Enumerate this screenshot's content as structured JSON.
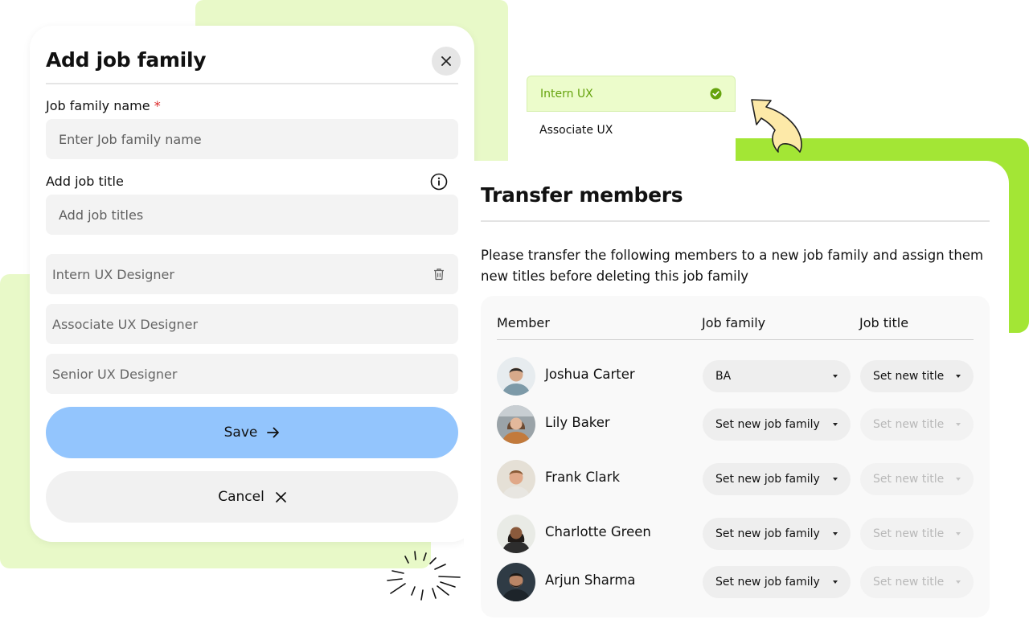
{
  "add_job_family_modal": {
    "title": "Add job family",
    "job_family_name_label": "Job family name",
    "required_marker": "*",
    "job_family_name_placeholder": "Enter Job family name",
    "add_job_title_label": "Add job title",
    "add_job_title_placeholder": "Add job titles",
    "job_titles": [
      "Intern UX Designer",
      "Associate UX Designer",
      "Senior UX Designer"
    ],
    "save_label": "Save",
    "cancel_label": "Cancel"
  },
  "title_dropdown": {
    "options": [
      {
        "label": "Intern UX",
        "selected": true
      },
      {
        "label": "Associate UX",
        "selected": false
      }
    ]
  },
  "transfer_members": {
    "title": "Transfer members",
    "description": "Please transfer the following members to a new job family and assign them new titles before deleting this job family",
    "columns": [
      "Member",
      "Job family",
      "Job title"
    ],
    "members": [
      {
        "name": "Joshua Carter",
        "job_family": "BA",
        "job_title": "Set new title",
        "title_enabled": true
      },
      {
        "name": "Lily Baker",
        "job_family": "Set new job family",
        "job_title": "Set new title",
        "title_enabled": false
      },
      {
        "name": "Frank Clark",
        "job_family": "Set new job family",
        "job_title": "Set new title",
        "title_enabled": false
      },
      {
        "name": "Charlotte Green",
        "job_family": "Set new job family",
        "job_title": "Set new title",
        "title_enabled": false
      },
      {
        "name": "Arjun Sharma",
        "job_family": "Set new job family",
        "job_title": "Set new title",
        "title_enabled": false
      }
    ]
  },
  "colors": {
    "lime_light": "#e8f9c8",
    "lime_accent": "#a3e635",
    "save_button": "#93c5fd",
    "check_green": "#65a30d",
    "required_red": "#dc2626"
  }
}
